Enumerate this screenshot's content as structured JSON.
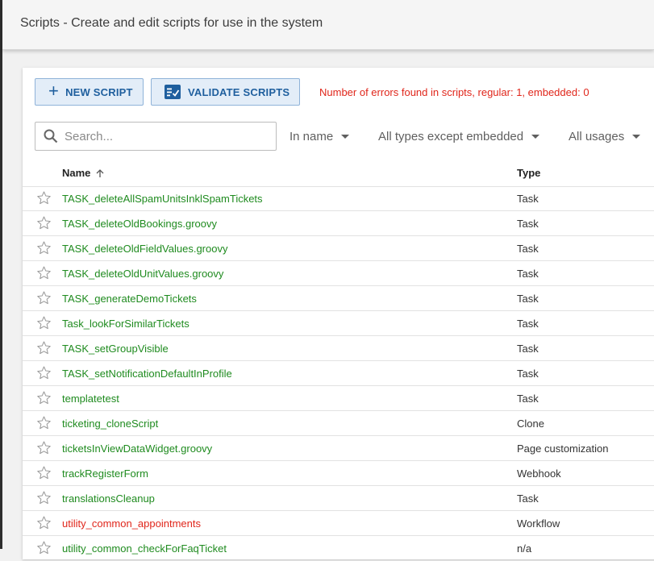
{
  "header": {
    "title": "Scripts - Create and edit scripts for use in the system"
  },
  "toolbar": {
    "new_label": "NEW SCRIPT",
    "validate_label": "VALIDATE SCRIPTS",
    "errors_message": "Number of errors found in scripts, regular: 1, embedded: 0"
  },
  "search": {
    "placeholder": "Search...",
    "value": ""
  },
  "filters": {
    "scope": "In name",
    "types": "All types except embedded",
    "usages": "All usages"
  },
  "columns": {
    "name": "Name",
    "type": "Type"
  },
  "colors": {
    "ok_name": "#1f8b1f",
    "error_name": "#e0261b",
    "button_text": "#1f5f9e"
  },
  "rows": [
    {
      "name": "TASK_deleteAllSpamUnitsInklSpamTickets",
      "type": "Task",
      "error": false
    },
    {
      "name": "TASK_deleteOldBookings.groovy",
      "type": "Task",
      "error": false
    },
    {
      "name": "TASK_deleteOldFieldValues.groovy",
      "type": "Task",
      "error": false
    },
    {
      "name": "TASK_deleteOldUnitValues.groovy",
      "type": "Task",
      "error": false
    },
    {
      "name": "TASK_generateDemoTickets",
      "type": "Task",
      "error": false
    },
    {
      "name": "Task_lookForSimilarTickets",
      "type": "Task",
      "error": false
    },
    {
      "name": "TASK_setGroupVisible",
      "type": "Task",
      "error": false
    },
    {
      "name": "TASK_setNotificationDefaultInProfile",
      "type": "Task",
      "error": false
    },
    {
      "name": "templatetest",
      "type": "Task",
      "error": false
    },
    {
      "name": "ticketing_cloneScript",
      "type": "Clone",
      "error": false
    },
    {
      "name": "ticketsInViewDataWidget.groovy",
      "type": "Page customization",
      "error": false
    },
    {
      "name": "trackRegisterForm",
      "type": "Webhook",
      "error": false
    },
    {
      "name": "translationsCleanup",
      "type": "Task",
      "error": false
    },
    {
      "name": "utility_common_appointments",
      "type": "Workflow",
      "error": true
    },
    {
      "name": "utility_common_checkForFaqTicket",
      "type": "n/a",
      "error": false
    }
  ]
}
